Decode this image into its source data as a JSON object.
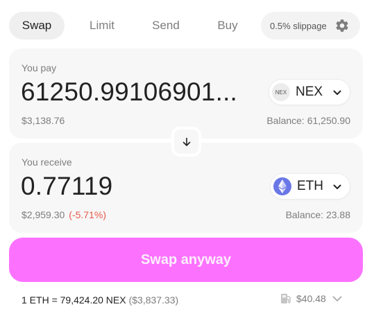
{
  "tabs": [
    "Swap",
    "Limit",
    "Send",
    "Buy"
  ],
  "settings": {
    "slippage_label": "0.5% slippage",
    "icon": "gear-icon"
  },
  "pay": {
    "label": "You pay",
    "amount": "61250.99106901...",
    "usd": "$3,138.76",
    "balance": "Balance: 61,250.90",
    "token": {
      "symbol": "NEX",
      "icon_text": "NEX"
    }
  },
  "receive": {
    "label": "You receive",
    "amount": "0.77119",
    "usd": "$2,959.30",
    "price_impact": "(-5.71%)",
    "balance": "Balance: 23.88",
    "token": {
      "symbol": "ETH",
      "icon": "ethereum-icon"
    }
  },
  "swap_button": {
    "label": "Swap anyway"
  },
  "footer": {
    "rate": "1 ETH = 79,424.20 NEX",
    "rate_usd": "($3,837.33)",
    "gas": "$40.48"
  },
  "colors": {
    "accent": "#fc72ff",
    "negative": "#e8584a",
    "eth": "#6a77e6"
  }
}
